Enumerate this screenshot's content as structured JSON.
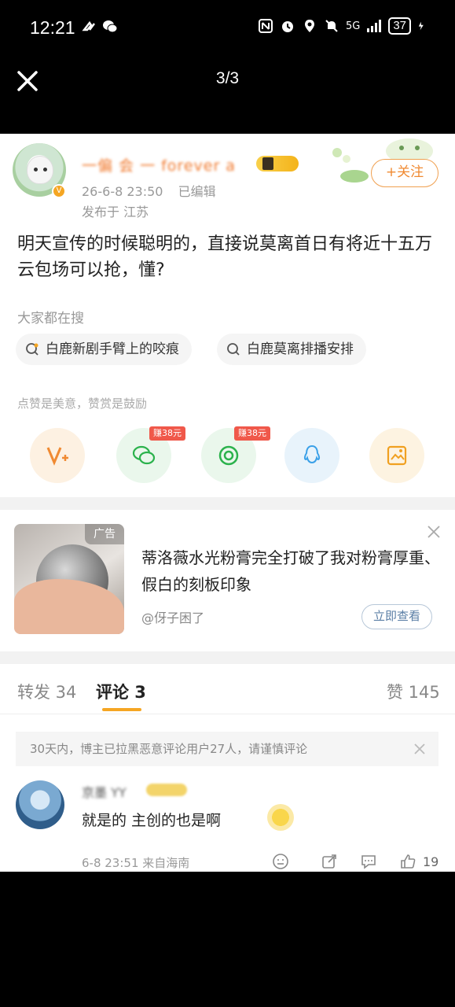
{
  "status_bar": {
    "time": "12:21",
    "network": "5G",
    "battery": "37"
  },
  "viewer": {
    "page_counter": "3/3"
  },
  "post": {
    "username": "一偏 会 一 forever a",
    "time": "26-6-8 23:50",
    "edited": "已编辑",
    "location": "发布于 江苏",
    "follow_label": "+关注",
    "text": "明天宣传的时候聪明的，直接说莫离首日有将近十五万云包场可以抢，懂?"
  },
  "search": {
    "title": "大家都在搜",
    "chips": [
      "白鹿新剧手臂上的咬痕",
      "白鹿莫离排播安排"
    ]
  },
  "reward": {
    "title": "点赞是美意，赞赏是鼓励",
    "earn_tag_1": "赚38元",
    "earn_tag_2": "赚38元"
  },
  "ad": {
    "tag": "广告",
    "text": "蒂洛薇水光粉膏完全打破了我对粉膏厚重、假白的刻板印象",
    "author": "@伢子困了",
    "button": "立即查看",
    "colors": {
      "accent": "#5b7fa6"
    }
  },
  "tabs": {
    "repost": "转发 34",
    "comments": "评论 3",
    "likes": "赞 145"
  },
  "notice": {
    "text": "30天内，博主已拉黑恶意评论用户27人，请谨慎评论"
  },
  "comment": {
    "name": "京墨 YY",
    "text": "就是的 主创的也是啊",
    "time": "6-8 23:51 来自海南",
    "likes": "19"
  },
  "colors": {
    "brand_orange": "#f08a32",
    "tab_underline": "#f5a623",
    "earn_tag": "#f0584a"
  }
}
